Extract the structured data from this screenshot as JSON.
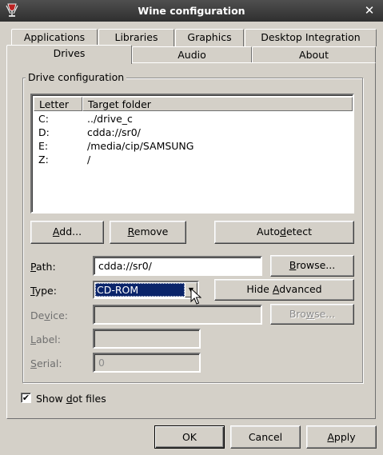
{
  "window": {
    "title": "Wine configuration",
    "close_glyph": "✕"
  },
  "tabs_row1": [
    "Applications",
    "Libraries",
    "Graphics",
    "Desktop Integration"
  ],
  "tabs_row2": [
    "Drives",
    "Audio",
    "About"
  ],
  "active_tab": "Drives",
  "group": {
    "title": "Drive configuration"
  },
  "drive_list": {
    "columns": [
      "Letter",
      "Target folder"
    ],
    "rows": [
      {
        "letter": "C:",
        "target": "../drive_c"
      },
      {
        "letter": "D:",
        "target": "cdda://sr0/"
      },
      {
        "letter": "E:",
        "target": "/media/cip/SAMSUNG"
      },
      {
        "letter": "Z:",
        "target": "/"
      }
    ]
  },
  "buttons": {
    "add": {
      "pre": "",
      "accel": "A",
      "post": "dd..."
    },
    "remove": {
      "pre": "",
      "accel": "R",
      "post": "emove"
    },
    "autodetect": {
      "pre": "Auto",
      "accel": "d",
      "post": "etect"
    },
    "browse_path": {
      "pre": "",
      "accel": "B",
      "post": "rowse..."
    },
    "hide_advanced": {
      "pre": "Hide ",
      "accel": "A",
      "post": "dvanced"
    },
    "browse_device": {
      "pre": "Bro",
      "accel": "w",
      "post": "se..."
    },
    "ok": "OK",
    "cancel": "Cancel",
    "apply": {
      "pre": "",
      "accel": "A",
      "post": "pply"
    }
  },
  "fields": {
    "path": {
      "label_pre": "",
      "label_accel": "P",
      "label_post": "ath:",
      "value": "cdda://sr0/"
    },
    "type": {
      "label_pre": "",
      "label_accel": "T",
      "label_post": "ype:",
      "value": "CD-ROM"
    },
    "device": {
      "label_pre": "De",
      "label_accel": "v",
      "label_post": "ice:",
      "value": ""
    },
    "label": {
      "label_pre": "",
      "label_accel": "L",
      "label_post": "abel:",
      "value": ""
    },
    "serial": {
      "label_pre": "",
      "label_accel": "S",
      "label_post": "erial:",
      "value": "0"
    }
  },
  "show_dot_files": {
    "pre": "Show ",
    "accel": "d",
    "post": "ot files",
    "checked": true,
    "mark": "✔"
  },
  "colors": {
    "selection": "#0a246a",
    "face": "#d4d0c8",
    "titlebar": "#3a3a3a"
  }
}
